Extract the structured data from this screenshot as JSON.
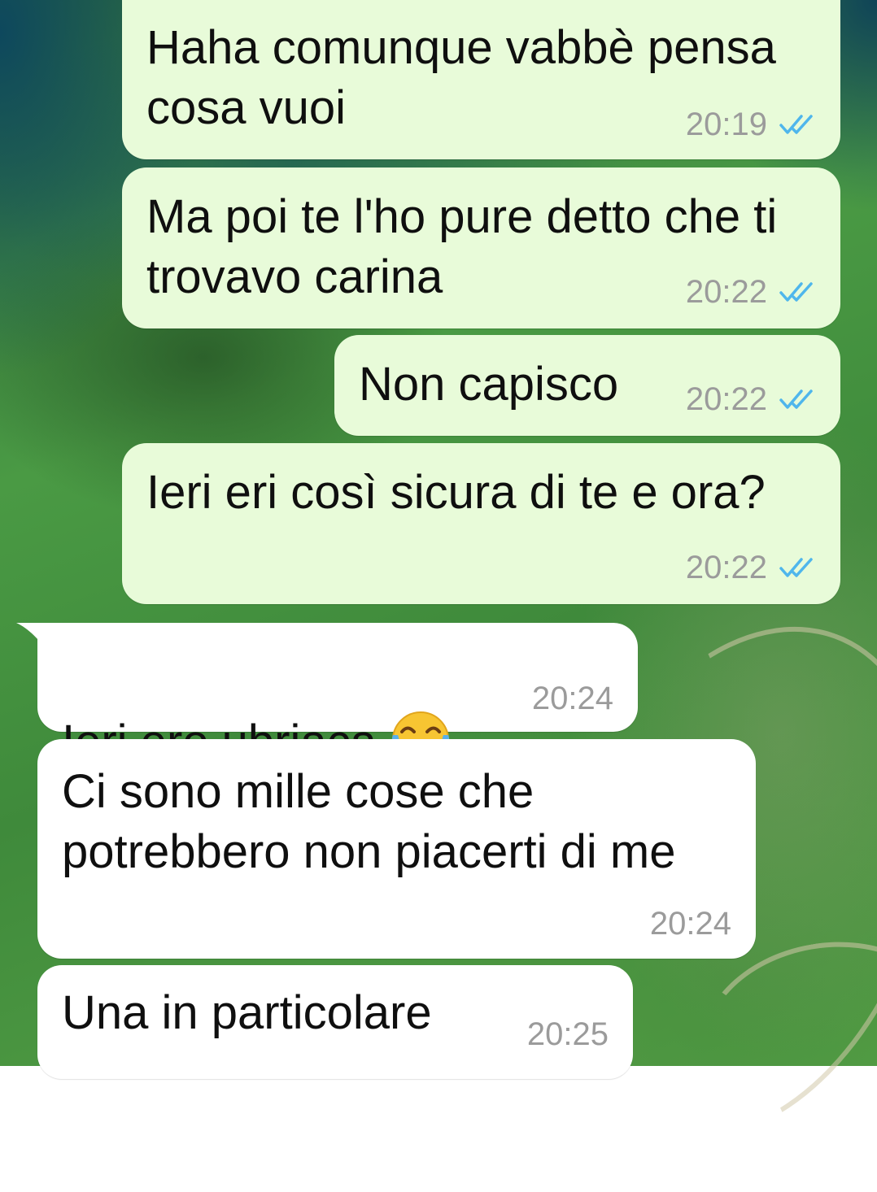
{
  "messages": [
    {
      "direction": "outgoing",
      "text": "Haha comunque vabbè pensa\ncosa vuoi",
      "time": "20:19",
      "status_icon": "double-check-read-icon"
    },
    {
      "direction": "outgoing",
      "text": "Ma poi te l'ho pure detto che ti\ntrovavo carina",
      "time": "20:22",
      "status_icon": "double-check-read-icon"
    },
    {
      "direction": "outgoing",
      "text": "Non capisco",
      "time": "20:22",
      "status_icon": "double-check-read-icon"
    },
    {
      "direction": "outgoing",
      "text": "Ieri eri così sicura di te e ora?",
      "time": "20:22",
      "status_icon": "double-check-read-icon"
    },
    {
      "direction": "incoming",
      "text": "Ieri ero ubriaca",
      "emoji": "😂",
      "emoji_icon": "face-with-tears-of-joy-icon",
      "time": "20:24"
    },
    {
      "direction": "incoming",
      "text": "Ci sono mille cose che\npotrebbero non piacerti di me",
      "time": "20:24"
    },
    {
      "direction": "incoming",
      "text": "Una in particolare",
      "time": "20:25"
    }
  ],
  "colors": {
    "outgoing_bubble": "#e8fbd9",
    "incoming_bubble": "#ffffff",
    "timestamp": "#9b9b9b",
    "read_ticks": "#4fb6ec",
    "wallpaper_green": "#4a9a44",
    "wallpaper_sea": "#0c465f"
  }
}
